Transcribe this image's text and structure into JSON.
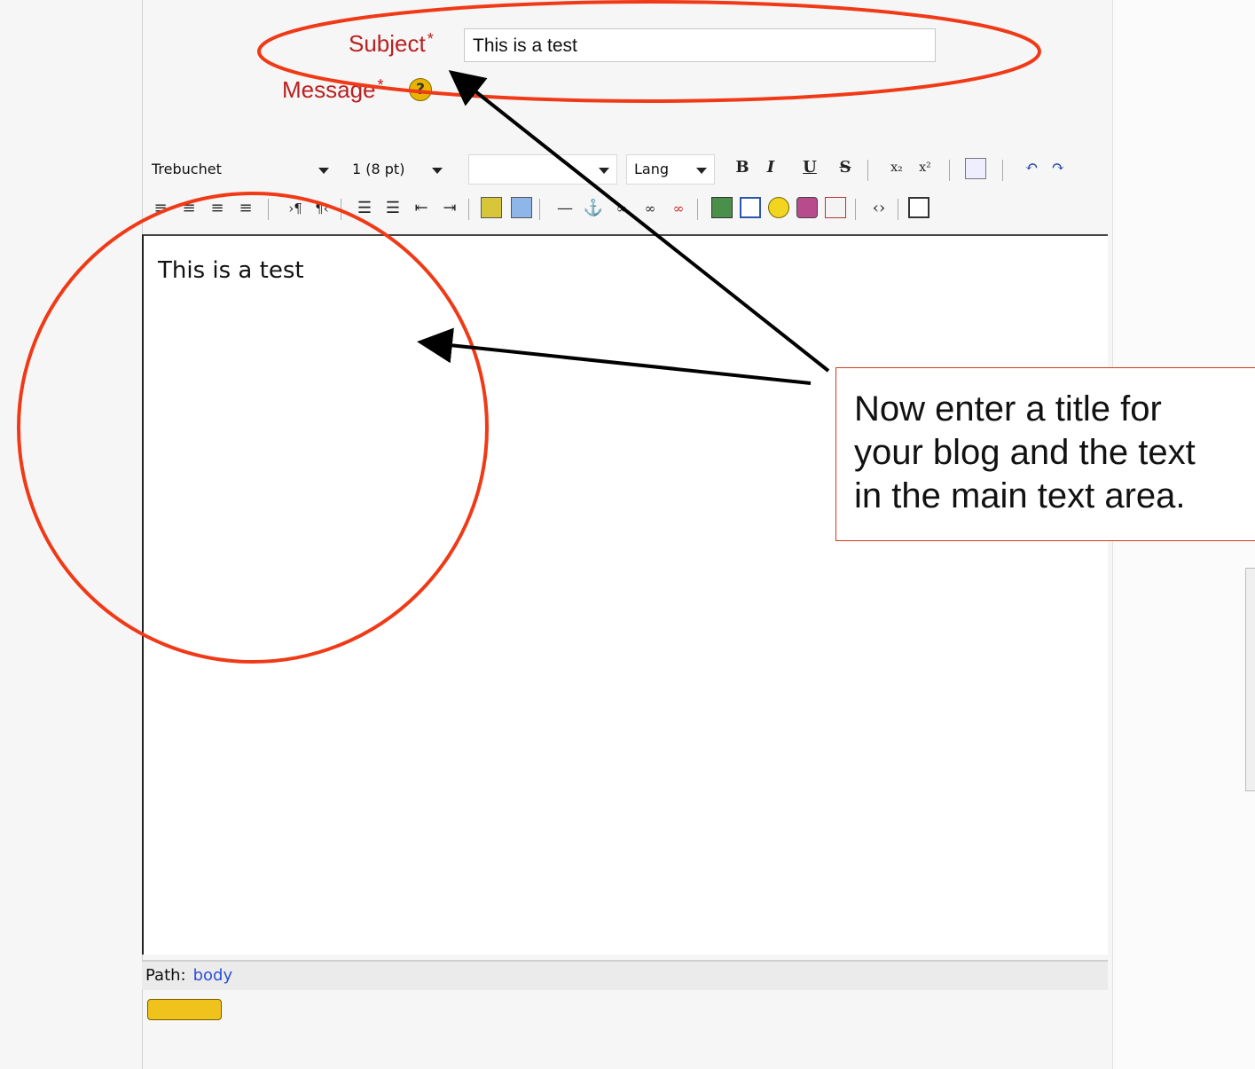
{
  "form": {
    "subject_label": "Subject",
    "message_label": "Message",
    "required_mark": "*",
    "subject_value": "This is a test"
  },
  "toolbar": {
    "font_family": "Trebuchet",
    "font_size": "1 (8 pt)",
    "heading": "",
    "lang": "Lang"
  },
  "editor": {
    "content": "This is a test"
  },
  "status": {
    "path_label": "Path:",
    "path_value": "body"
  },
  "callout": {
    "lines": [
      "Now enter a title for",
      "your blog and the text",
      "in the main text area."
    ]
  },
  "colors": {
    "annotation_red": "#f03a17",
    "label_red": "#b92121"
  }
}
